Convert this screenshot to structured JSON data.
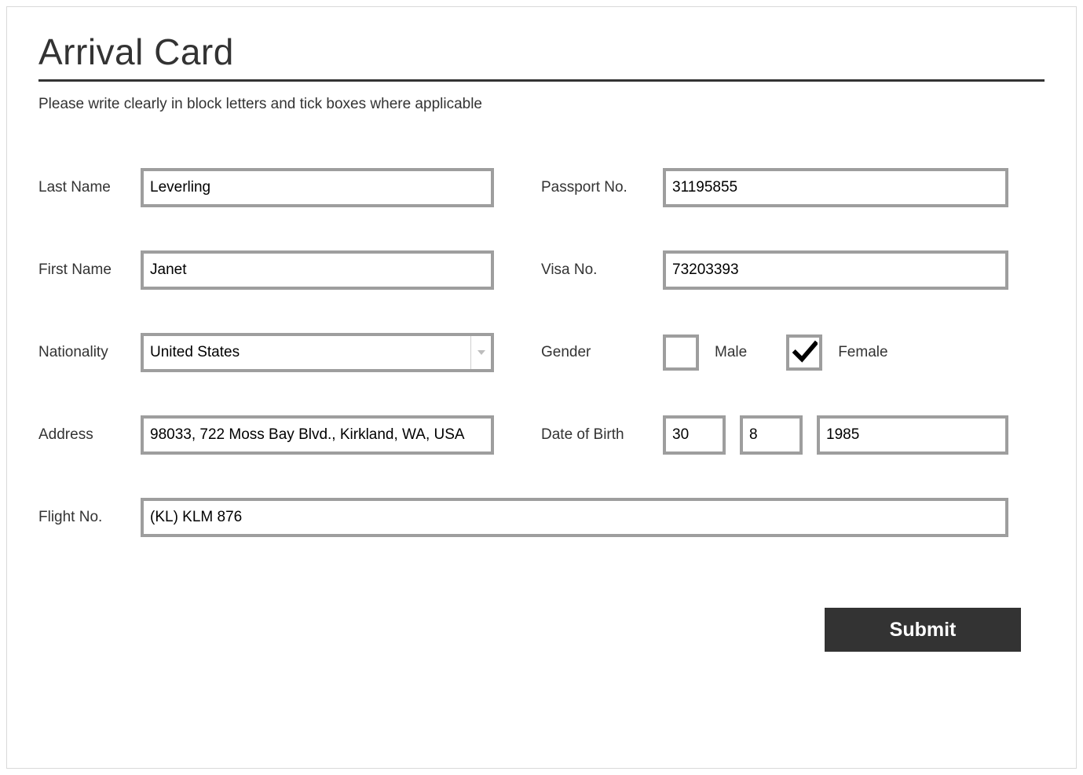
{
  "header": {
    "title": "Arrival Card",
    "instructions": "Please write clearly in block letters and tick boxes where applicable"
  },
  "labels": {
    "last_name": "Last Name",
    "first_name": "First Name",
    "nationality": "Nationality",
    "address": "Address",
    "passport_no": "Passport No.",
    "visa_no": "Visa No.",
    "gender": "Gender",
    "male": "Male",
    "female": "Female",
    "dob": "Date of Birth",
    "flight_no": "Flight No."
  },
  "values": {
    "last_name": "Leverling",
    "first_name": "Janet",
    "nationality": "United States",
    "address": "98033, 722 Moss Bay Blvd., Kirkland, WA, USA",
    "passport_no": "31195855",
    "visa_no": "73203393",
    "gender_male_checked": false,
    "gender_female_checked": true,
    "dob_day": "30",
    "dob_month": "8",
    "dob_year": "1985",
    "flight_no": "(KL) KLM 876"
  },
  "buttons": {
    "submit": "Submit"
  }
}
